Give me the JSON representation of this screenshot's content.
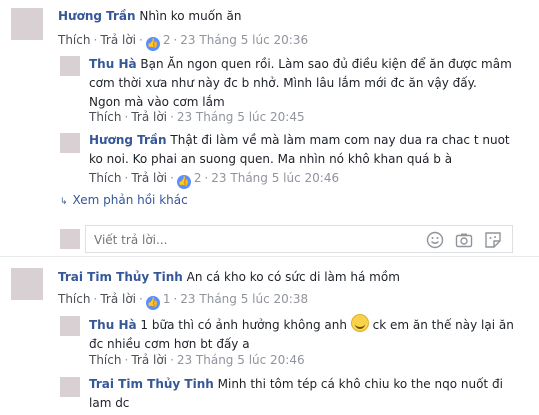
{
  "comments": [
    {
      "author": "Hương Trần",
      "text": "Nhìn ko muốn ăn",
      "like": "Thích",
      "reply": "Trả lời",
      "reactions": "2",
      "time": "23 Tháng 5 lúc 20:36"
    },
    {
      "author": "Thu Hà",
      "text_line1": "Bạn Ăn ngon quen rồi. Làm sao đủ điều kiện để ăn được mâm",
      "text_line2": "cơm thời xưa như này đc b nhở. Mình lâu lắm mới đc ăn vậy đấy.",
      "text_line3": "Ngon mà vào cơm lắm",
      "like": "Thích",
      "reply": "Trả lời",
      "time": "23 Tháng 5 lúc 20:45"
    },
    {
      "author": "Hương Trần",
      "text_line1": "Thật đi làm về mà làm mam com nay dua ra chac t nuot",
      "text_line2": "ko noi. Ko phai an suong quen. Ma nhìn nó khô khan quá b à",
      "like": "Thích",
      "reply": "Trả lời",
      "reactions": "2",
      "time": "23 Tháng 5 lúc 20:46"
    },
    {
      "author": "Trai Tim Thủy Tinh",
      "text": "An cá kho ko có sức di làm há mồm",
      "like": "Thích",
      "reply": "Trả lời",
      "reactions": "1",
      "time": "23 Tháng 5 lúc 20:38"
    },
    {
      "author": "Thu Hà",
      "text_line1a": "1 bữa thì có ảnh hưởng không anh",
      "text_line1b": "ck em ăn thế này lại ăn",
      "text_line2": "đc nhiều cơm hơn bt đấy a",
      "like": "Thích",
      "reply": "Trả lời",
      "time": "23 Tháng 5 lúc 20:46"
    },
    {
      "author": "Trai Tim Thủy Tinh",
      "text_line1": "Minh thi tôm tép cá khô chiu ko the nqo nuốt đi",
      "text_line2": "lam dc"
    }
  ],
  "more_replies": "Xem phản hồi khác",
  "reply_input": {
    "placeholder": "Viết trả lời..."
  },
  "icons": {
    "emoji": "smile-icon",
    "camera": "camera-icon",
    "sticker": "sticker-icon"
  },
  "colors": {
    "link": "#365899",
    "meta": "#90949c",
    "like_badge": "#5890ff"
  },
  "glyphs": {
    "like": "👍",
    "sep": "·",
    "more_arrow": "↳"
  }
}
